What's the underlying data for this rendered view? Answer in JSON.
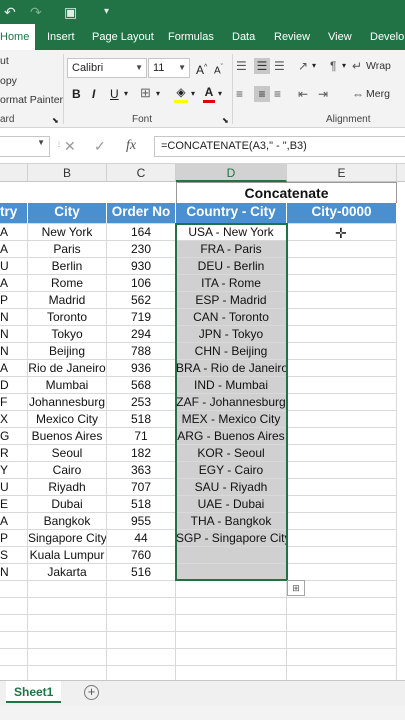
{
  "ribbon_tabs": [
    "Home",
    "Insert",
    "Page Layout",
    "Formulas",
    "Data",
    "Review",
    "View",
    "Develo"
  ],
  "clipboard": {
    "cut": "ut",
    "copy": "opy",
    "format_painter": "ormat Painter",
    "group_label": "ard"
  },
  "font": {
    "name": "Calibri",
    "size": "11",
    "group_label": "Font"
  },
  "alignment": {
    "wrap": "Wrap",
    "merge": "Merg",
    "group_label": "Alignment"
  },
  "formula_bar": {
    "formula": "=CONCATENATE(A3,\" - \",B3)"
  },
  "columns": [
    "B",
    "C",
    "D",
    "E"
  ],
  "sheet": {
    "title": "Concatenate",
    "headers": {
      "a": "try",
      "b": "City",
      "c": "Order No",
      "d": "Country - City",
      "e": "City-0000"
    },
    "rows": [
      {
        "a": "A",
        "b": "New York",
        "c": "164",
        "d": "USA - New York"
      },
      {
        "a": "A",
        "b": "Paris",
        "c": "230",
        "d": "FRA - Paris"
      },
      {
        "a": "U",
        "b": "Berlin",
        "c": "930",
        "d": "DEU - Berlin"
      },
      {
        "a": "A",
        "b": "Rome",
        "c": "106",
        "d": "ITA - Rome"
      },
      {
        "a": "P",
        "b": "Madrid",
        "c": "562",
        "d": "ESP - Madrid"
      },
      {
        "a": "N",
        "b": "Toronto",
        "c": "719",
        "d": "CAN - Toronto"
      },
      {
        "a": "N",
        "b": "Tokyo",
        "c": "294",
        "d": "JPN - Tokyo"
      },
      {
        "a": "N",
        "b": "Beijing",
        "c": "788",
        "d": "CHN - Beijing"
      },
      {
        "a": "A",
        "b": "Rio de Janeiro",
        "c": "936",
        "d": "BRA - Rio de Janeiro"
      },
      {
        "a": "D",
        "b": "Mumbai",
        "c": "568",
        "d": "IND - Mumbai"
      },
      {
        "a": "F",
        "b": "Johannesburg",
        "c": "253",
        "d": "ZAF - Johannesburg"
      },
      {
        "a": "X",
        "b": "Mexico City",
        "c": "518",
        "d": "MEX - Mexico City"
      },
      {
        "a": "G",
        "b": "Buenos Aires",
        "c": "71",
        "d": "ARG - Buenos Aires"
      },
      {
        "a": "R",
        "b": "Seoul",
        "c": "182",
        "d": "KOR - Seoul"
      },
      {
        "a": "Y",
        "b": "Cairo",
        "c": "363",
        "d": "EGY - Cairo"
      },
      {
        "a": "U",
        "b": "Riyadh",
        "c": "707",
        "d": "SAU - Riyadh"
      },
      {
        "a": "E",
        "b": "Dubai",
        "c": "518",
        "d": "UAE - Dubai"
      },
      {
        "a": "A",
        "b": "Bangkok",
        "c": "955",
        "d": "THA - Bangkok"
      },
      {
        "a": "P",
        "b": "Singapore City",
        "c": "44",
        "d": "SGP - Singapore City"
      },
      {
        "a": "S",
        "b": "Kuala Lumpur",
        "c": "760",
        "d": ""
      },
      {
        "a": "N",
        "b": "Jakarta",
        "c": "516",
        "d": ""
      }
    ]
  },
  "sheet_tab": "Sheet1",
  "colors": {
    "excel_green": "#217346",
    "header_blue": "#4a8fcf",
    "selection_gray": "#d0d0d0"
  }
}
